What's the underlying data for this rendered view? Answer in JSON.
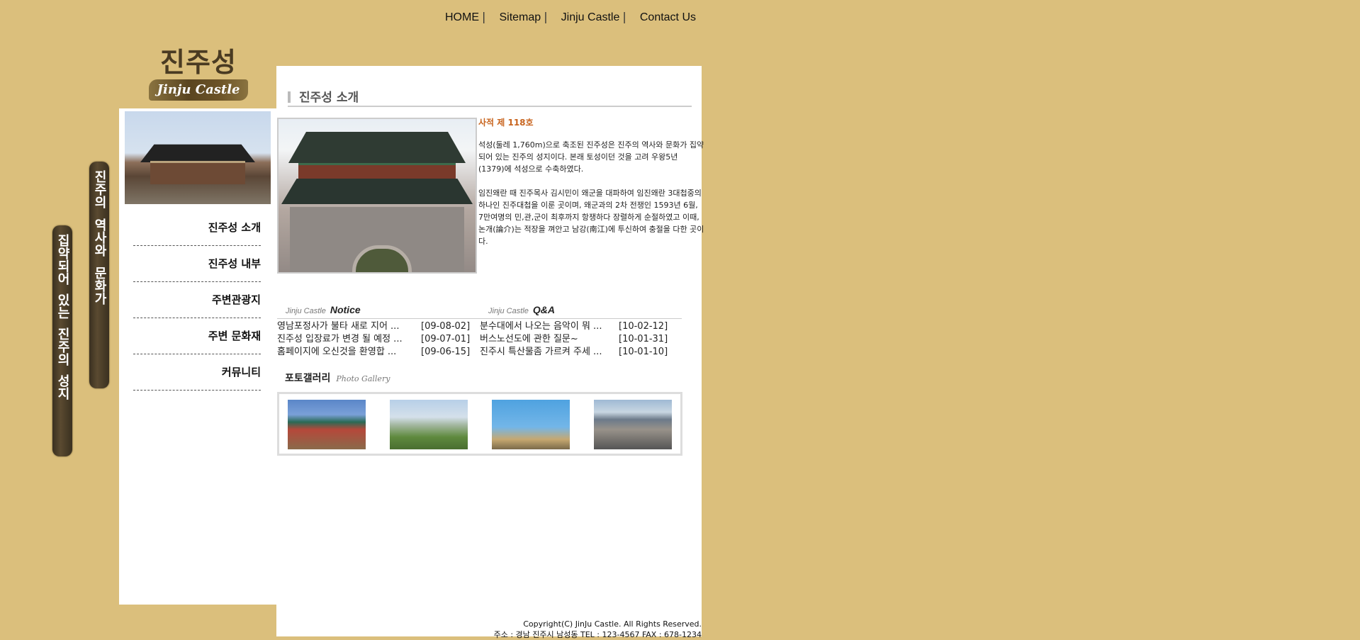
{
  "topnav": {
    "items": [
      "HOME",
      "Sitemap",
      "Jinju Castle",
      "Contact Us"
    ],
    "separator": "|"
  },
  "logo": {
    "korean": "진주성",
    "english": "Jinju Castle"
  },
  "vertical_banners": {
    "right": [
      "진주의",
      "역사와",
      "문화가"
    ],
    "left": [
      "집약되어",
      "있는",
      "진주의",
      "성지"
    ]
  },
  "sidebar": {
    "menu": [
      "진주성 소개",
      "진주성 내부",
      "주변관광지",
      "주변 문화재",
      "커뮤니티"
    ]
  },
  "main": {
    "section_title": "진주성 소개",
    "heading": "사적 제 118호",
    "paragraph1": "석성(둘레 1,760m)으로 축조된 진주성은 진주의 역사와 문화가 집약되어 있는 진주의 성지이다. 본래 토성이던 것을 고려 우왕5년 (1379)에 석성으로 수축하였다.",
    "paragraph2": "임진왜란 때 진주목사 김시민이 왜군을 대파하여 임진왜란 3대첩중의 하나인 진주대첩을 이룬 곳이며, 왜군과의 2차 전쟁인 1593년 6월, 7만여명의 민,관,군이 최후까지 항쟁하다 장렬하게 순절하였고 이때, 논개(論介)는 적장을 껴안고 남강(南江)에 투신하여 충절을 다한 곳이다."
  },
  "notice": {
    "brand": "Jinju Castle",
    "title": "Notice",
    "rows": [
      {
        "text": "영남포정사가 불타 새로 지어 ...",
        "date": "[09-08-02]"
      },
      {
        "text": "진주성 입장료가 변경 될 예정 ...",
        "date": "[09-07-01]"
      },
      {
        "text": "홈페이지에 오신것을 환영합 ...",
        "date": "[09-06-15]"
      }
    ]
  },
  "qna": {
    "brand": "Jinju Castle",
    "title": "Q&A",
    "rows": [
      {
        "text": "분수대에서 나오는 음악이 뭐 ...",
        "date": "[10-02-12]"
      },
      {
        "text": "버스노선도에 관한 질문~",
        "date": "[10-01-31]"
      },
      {
        "text": "진주시 특산물좀 가르켜 주세 ...",
        "date": "[10-01-10]"
      }
    ]
  },
  "gallery": {
    "title": "포토갤러리",
    "subtitle": "Photo Gallery"
  },
  "footer": {
    "copyright": "Copyright(C) JinJu Castle. All Rights Reserved.",
    "address": "주소 : 경남 진주시 남성동 TEL : 123-4567 FAX : 678-1234"
  }
}
